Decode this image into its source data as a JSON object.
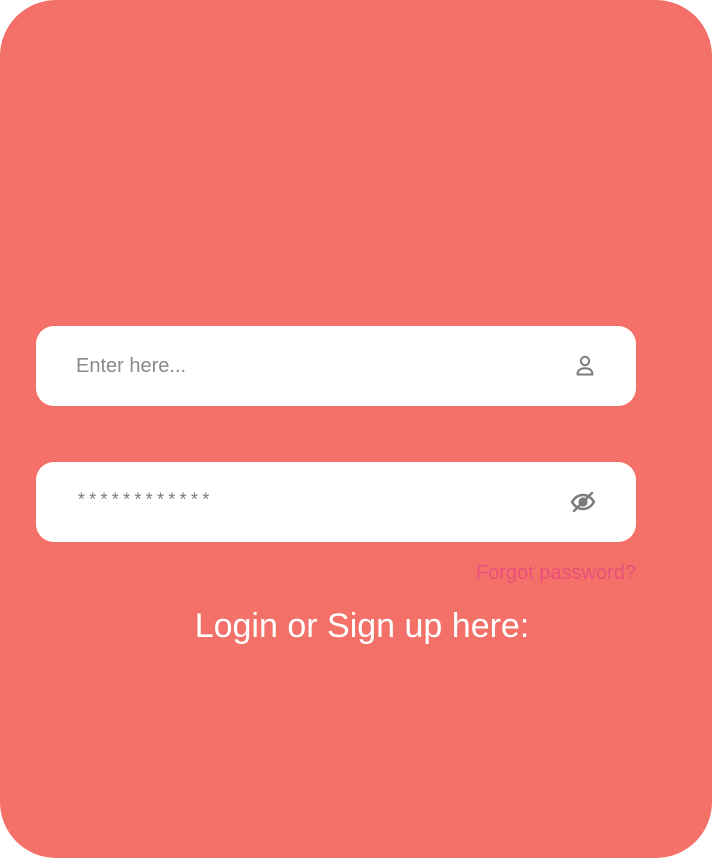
{
  "colors": {
    "background": "#f37169",
    "field_background": "#ffffff",
    "placeholder_text": "#8a8a8a",
    "icon": "#7b7b7b",
    "forgot_link": "#ea4f7a",
    "heading_text": "#ffffff"
  },
  "form": {
    "username": {
      "placeholder": "Enter here...",
      "value": "",
      "icon": "user-icon"
    },
    "password": {
      "masked_value": "************",
      "icon": "eye-off-icon"
    },
    "forgot_label": "Forgot password?",
    "cta_text": "Login or Sign up here:"
  }
}
